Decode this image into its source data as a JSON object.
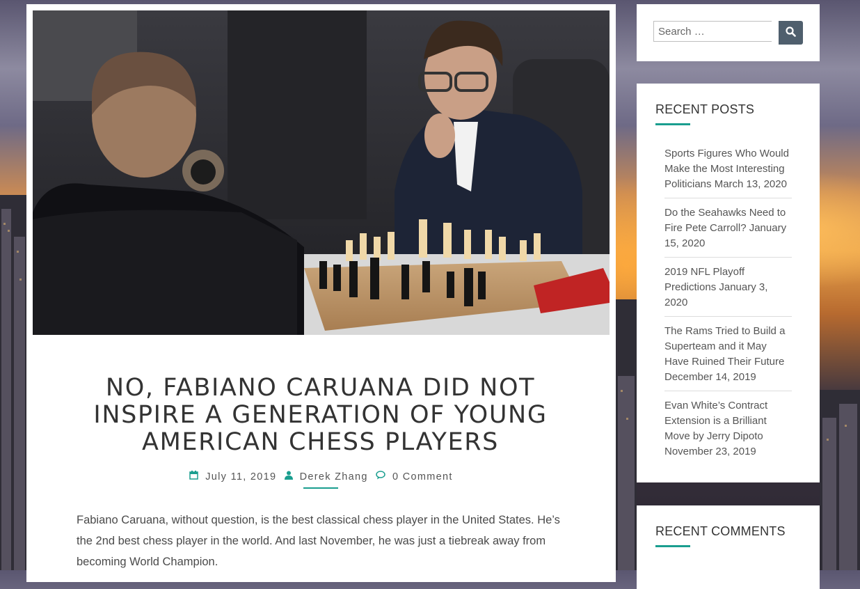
{
  "search": {
    "placeholder": "Search …",
    "button_icon": "search-icon"
  },
  "post": {
    "title": "NO, FABIANO CARUANA DID NOT INSPIRE A GENERATION OF YOUNG AMERICAN CHESS PLAYERS",
    "date": "July 11, 2019",
    "author": "Derek Zhang",
    "comments": "0 Comment",
    "excerpt": "Fabiano Caruana, without question, is the best classical chess player in the United States. He’s the 2nd best chess player in the world. And last November, he was just a tiebreak away from becoming World Champion."
  },
  "recent_posts": {
    "title": "RECENT POSTS",
    "items": [
      {
        "label": "Sports Figures Who Would Make the Most Interesting Politicians",
        "date": "March 13, 2020"
      },
      {
        "label": "Do the Seahawks Need to Fire Pete Carroll?",
        "date": "January 15, 2020"
      },
      {
        "label": "2019 NFL Playoff Predictions",
        "date": "January 3, 2020"
      },
      {
        "label": "The Rams Tried to Build a Superteam and it May Have Ruined Their Future",
        "date": "December 14, 2019"
      },
      {
        "label": "Evan White’s Contract Extension is a Brilliant Move by Jerry Dipoto",
        "date": "November 23, 2019"
      }
    ]
  },
  "recent_comments": {
    "title": "RECENT COMMENTS"
  },
  "colors": {
    "accent": "#1a9e8f",
    "search_button": "#4f5f6d"
  }
}
